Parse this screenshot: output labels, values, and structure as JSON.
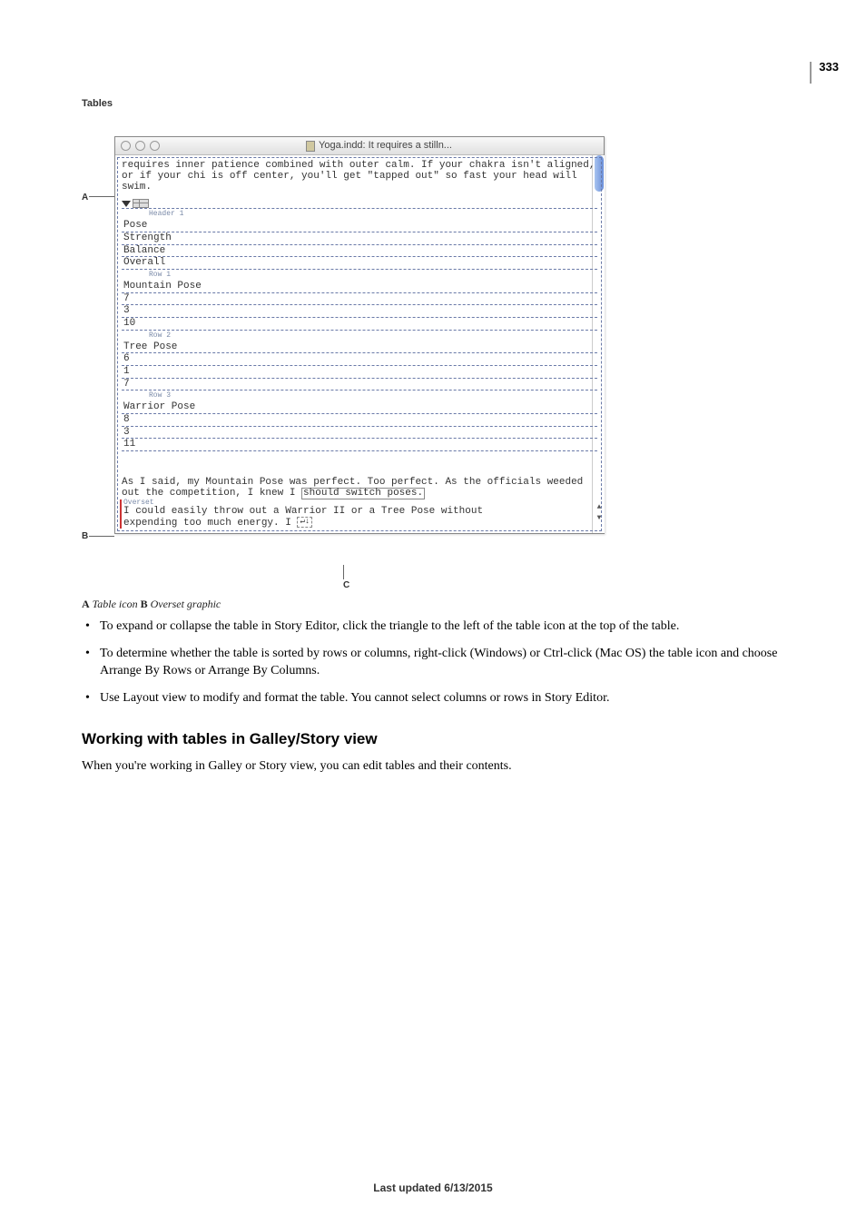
{
  "page_number": "333",
  "section_label": "Tables",
  "callouts": {
    "A": "A",
    "B": "B",
    "C": "C"
  },
  "caption": {
    "A_label": "A",
    "A_text": " Table icon  ",
    "B_label": "B",
    "B_text": " Overset graphic"
  },
  "window": {
    "title": "Yoga.indd: It requires a stilln...",
    "para1": "requires inner patience combined with outer calm. If your chakra isn't aligned, or if your chi is off center, you'll get \"tapped out\" so fast your head will swim.",
    "header1_label": "Header 1",
    "headers": [
      "Pose",
      "Strength",
      "Balance",
      "Overall"
    ],
    "row1_label": "Row 1",
    "row1": [
      "Mountain Pose",
      "7",
      "3",
      "10"
    ],
    "row2_label": "Row 2",
    "row2": [
      "Tree Pose",
      "6",
      "1",
      "7"
    ],
    "row3_label": "Row 3",
    "row3": [
      "Warrior Pose",
      "8",
      "3",
      "11"
    ],
    "para2a": "As I said, my Mountain Pose was perfect. Too perfect. As the officials weeded out the competition, I knew I ",
    "para2_box": "should switch poses.",
    "overset_label": "Overset",
    "para2b": "I could easily throw out a Warrior II or a Tree Pose without",
    "para2c": "expending too much energy. I ",
    "overset_icon": "↵↓"
  },
  "bullets": [
    "To expand or collapse the table in Story Editor, click the triangle to the left of the table icon at the top of the table.",
    "To determine whether the table is sorted by rows or columns, right-click (Windows) or Ctrl-click (Mac OS) the table icon and choose Arrange By Rows or Arrange By Columns.",
    "Use Layout view to modify and format the table. You cannot select columns or rows in Story Editor."
  ],
  "subheading": "Working with tables in Galley/Story view",
  "subpara": "When you're working in Galley or Story view, you can edit tables and their contents.",
  "footer": "Last updated 6/13/2015"
}
